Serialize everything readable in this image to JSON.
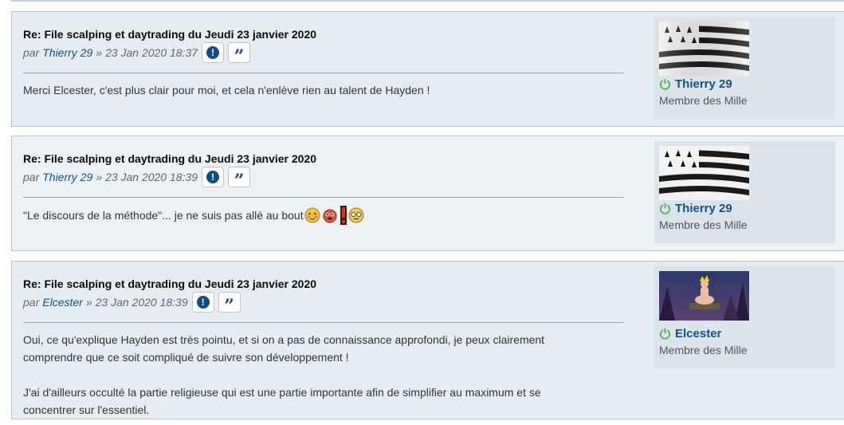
{
  "posts": [
    {
      "title": "Re: File scalping et daytrading du Jeudi 23 janvier 2020",
      "by": "par",
      "author": "Thierry 29",
      "sep": "»",
      "time": "23 Jan 2020 18:37",
      "paragraphs": [
        "Merci Elcester, c'est plus clair pour moi, et cela n'enlève rien au talent de Hayden !"
      ],
      "profile": {
        "name": "Thierry 29",
        "rank": "Membre des Mille",
        "avatar": "breton-flag-icon"
      }
    },
    {
      "title": "Re: File scalping et daytrading du Jeudi 23 janvier 2020",
      "by": "par",
      "author": "Thierry 29",
      "sep": "»",
      "time": "23 Jan 2020 18:39",
      "paragraphs": [
        "\"Le discours de la méthode\"... je ne suis pas allé au bout"
      ],
      "smilies": [
        "blushing-smiley-icon",
        "bouncing-smiley-icon",
        "exclamation-smiley-icon",
        "nerd-smiley-icon"
      ],
      "profile": {
        "name": "Thierry 29",
        "rank": "Membre des Mille",
        "avatar": "breton-flag-icon"
      }
    },
    {
      "title": "Re: File scalping et daytrading du Jeudi 23 janvier 2020",
      "by": "par",
      "author": "Elcester",
      "sep": "»",
      "time": "23 Jan 2020 18:39",
      "paragraphs": [
        "Oui, ce qu'explique Hayden est très pointu, et si on a pas de connaissance approfondi, je peux clairement comprendre que ce soit compliqué de suivre son développement !",
        "J'ai d'ailleurs occulté la partie religieuse qui est une partie importante afin de simplifier au maximum et se concentrer sur l'essentiel."
      ],
      "profile": {
        "name": "Elcester",
        "rank": "Membre des Mille",
        "avatar": "meditating-figure-avatar-icon"
      }
    }
  ],
  "colors": {
    "link": "#105289",
    "online": "#5cb85c",
    "panel": "#e5edf3"
  }
}
